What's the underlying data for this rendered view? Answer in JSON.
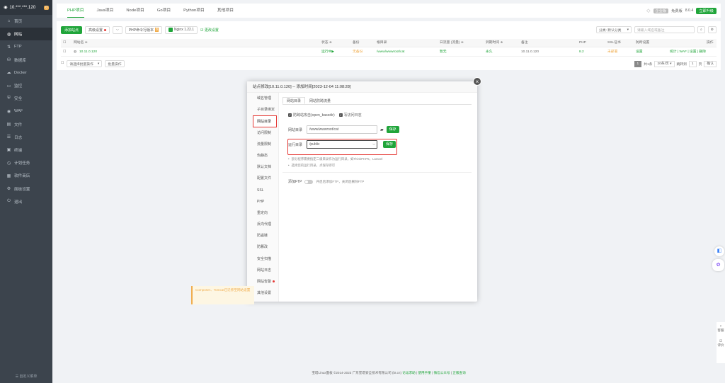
{
  "sidebar": {
    "host": "10.***.***.120",
    "badge": "0",
    "items": [
      {
        "label": "首页",
        "icon": "home-icon",
        "glyph": "⌂"
      },
      {
        "label": "网站",
        "icon": "globe-icon",
        "glyph": "◍"
      },
      {
        "label": "FTP",
        "icon": "ftp-icon",
        "glyph": "⇅"
      },
      {
        "label": "数据库",
        "icon": "database-icon",
        "glyph": "⛁"
      },
      {
        "label": "Docker",
        "icon": "docker-icon",
        "glyph": "☁"
      },
      {
        "label": "监控",
        "icon": "monitor-icon",
        "glyph": "▭"
      },
      {
        "label": "安全",
        "icon": "shield-icon",
        "glyph": "⛨"
      },
      {
        "label": "WAF",
        "icon": "waf-icon",
        "glyph": "◉"
      },
      {
        "label": "文件",
        "icon": "folder-icon",
        "glyph": "▤"
      },
      {
        "label": "日志",
        "icon": "log-icon",
        "glyph": "☰"
      },
      {
        "label": "终端",
        "icon": "terminal-icon",
        "glyph": "▣"
      },
      {
        "label": "计划任务",
        "icon": "clock-icon",
        "glyph": "◷"
      },
      {
        "label": "软件商店",
        "icon": "store-icon",
        "glyph": "▦"
      },
      {
        "label": "面板设置",
        "icon": "gear-icon",
        "glyph": "⚙"
      },
      {
        "label": "退出",
        "icon": "logout-icon",
        "glyph": "⏻"
      }
    ],
    "active_index": 1,
    "bottom": "☰ 自定义菜单"
  },
  "top_tabs": [
    "PHP项目",
    "Java项目",
    "Node项目",
    "Go项目",
    "Python项目",
    "其他项目"
  ],
  "top_right": {
    "pro_label": "企业版",
    "expire": "免费版",
    "version": "8.0.4",
    "upgrade": "立即升级"
  },
  "toolbar": {
    "add_site": "添加站点",
    "advanced": "高级设置",
    "php_version_prefix": "PHP命令行版本",
    "php_version_badge": "8",
    "nginx": "Nginx 1.22.1",
    "link": "☑ 更改设置",
    "category": "分类: 默认分类",
    "search_placeholder": "请输入域名或备注"
  },
  "table": {
    "headers": [
      "网站名 ≑",
      "状态 ≑",
      "备份",
      "根目录",
      "日流量 (流量) ≑",
      "到期时间 ≑",
      "备注",
      "PHP",
      "SSL证书",
      "防跨设置",
      "操作"
    ],
    "row": {
      "name": "10.11.0.120",
      "status": "运行中▶",
      "backup": "无备份",
      "root": "/www/wwwroot/cat",
      "traffic": "暂无",
      "expire": "永久",
      "note": "10.11.0.120",
      "php": "8.2",
      "ssl": "未部署",
      "guard": "设置",
      "ops": "统计 | WAF | 设置 | 删除"
    },
    "batch": "请选择批量操作",
    "batch_btn": "批量操作",
    "pager": {
      "current": "1",
      "total": "共1条",
      "per_page": "20条/页",
      "jump_label": "跳转到",
      "jump_page": "1",
      "page_unit": "页",
      "confirm": "确认"
    }
  },
  "modal": {
    "title": "站点修改[10.11.0.120] -- 添加时间[2023-12-04 11:08:28]",
    "nav": [
      "域名管理",
      "子目录绑定",
      "网站目录",
      "访问限制",
      "流量限制",
      "伪静态",
      "默认文档",
      "配置文件",
      "SSL",
      "PHP",
      "重定向",
      "反向代理",
      "防盗链",
      "防篡改",
      "安全扫描",
      "网站日志",
      "网站告警",
      "其他设置"
    ],
    "nav_active": 2,
    "tabs": [
      "网站目录",
      "网站防跨流量"
    ],
    "check1": "防跨站攻击(open_basedir)",
    "check2": "写访问日志",
    "dir_label": "网站目录",
    "dir_value": "/www/wwwroot/cat",
    "save": "保存",
    "run_label": "运行目录",
    "run_value": "/public",
    "tip1": "部分程序需要指定二级目录作为运行目录，如ThinkPHP5，Laravel",
    "tip2": "选择您的运行目录，点保存即可",
    "ftp_label": "添加FTP",
    "ftp_desc": "开启后添加FTP，关闭后删除FTP"
  },
  "toast": "Composer、Tomcat已迁移至网站设置",
  "footer": {
    "copyright": "宝塔Linux面板 ©2014-2023 广东堡塔安全技术有限公司 (bt.cn)",
    "links": [
      "论坛求助",
      "使用手册",
      "微信公众号",
      "正版查询"
    ]
  },
  "right_side": {
    "service": "客服",
    "review": "评价"
  }
}
